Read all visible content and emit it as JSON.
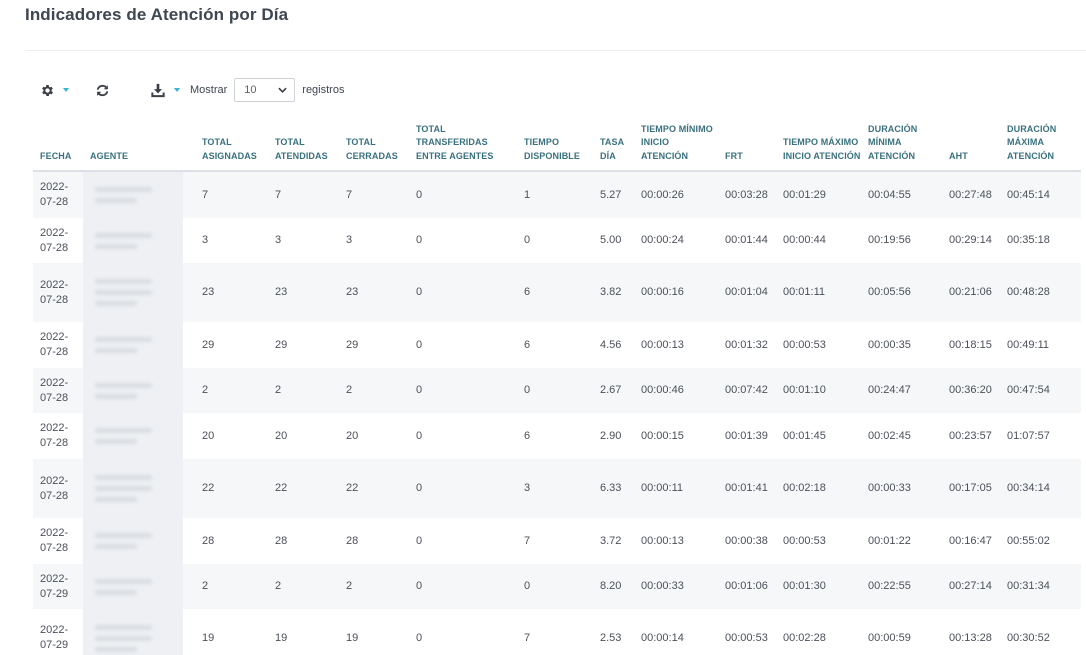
{
  "page": {
    "title": "Indicadores de Atención por Día"
  },
  "toolbar": {
    "settings_icon": "gear-icon",
    "refresh_icon": "refresh-icon",
    "download_icon": "download-icon",
    "show_label": "Mostrar",
    "page_length": "10",
    "records_label": "registros"
  },
  "table": {
    "headers": {
      "fecha": "FECHA",
      "agente": "AGENTE",
      "total_asignadas": "TOTAL ASIGNADAS",
      "total_atendidas": "TOTAL ATENDIDAS",
      "total_cerradas": "TOTAL CERRADAS",
      "total_transferidas": "TOTAL TRANSFERIDAS ENTRE AGENTES",
      "tiempo_disponible": "TIEMPO DISPONIBLE",
      "tasa_dia": "TASA DÍA",
      "tiempo_minimo": "TIEMPO MÍNIMO INICIO ATENCIÓN",
      "frt": "FRT",
      "tiempo_maximo": "TIEMPO MÁXIMO INICIO ATENCIÓN",
      "duracion_minima": "DURACIÓN MÍNIMA ATENCIÓN",
      "aht": "AHT",
      "duracion_maxima": "DURACIÓN MÁXIMA ATENCIÓN"
    },
    "rows": [
      {
        "fecha_a": "2022-",
        "fecha_b": "07-28",
        "asignadas": "7",
        "atendidas": "7",
        "cerradas": "7",
        "transferidas": "0",
        "disponible": "1",
        "tasa": "5.27",
        "t_min": "00:00:26",
        "frt": "00:03:28",
        "t_max": "00:01:29",
        "d_min": "00:04:55",
        "aht": "00:27:48",
        "d_max": "00:45:14"
      },
      {
        "fecha_a": "2022-",
        "fecha_b": "07-28",
        "asignadas": "3",
        "atendidas": "3",
        "cerradas": "3",
        "transferidas": "0",
        "disponible": "0",
        "tasa": "5.00",
        "t_min": "00:00:24",
        "frt": "00:01:44",
        "t_max": "00:00:44",
        "d_min": "00:19:56",
        "aht": "00:29:14",
        "d_max": "00:35:18"
      },
      {
        "fecha_a": "2022-",
        "fecha_b": "07-28",
        "asignadas": "23",
        "atendidas": "23",
        "cerradas": "23",
        "transferidas": "0",
        "disponible": "6",
        "tasa": "3.82",
        "t_min": "00:00:16",
        "frt": "00:01:04",
        "t_max": "00:01:11",
        "d_min": "00:05:56",
        "aht": "00:21:06",
        "d_max": "00:48:28"
      },
      {
        "fecha_a": "2022-",
        "fecha_b": "07-28",
        "asignadas": "29",
        "atendidas": "29",
        "cerradas": "29",
        "transferidas": "0",
        "disponible": "6",
        "tasa": "4.56",
        "t_min": "00:00:13",
        "frt": "00:01:32",
        "t_max": "00:00:53",
        "d_min": "00:00:35",
        "aht": "00:18:15",
        "d_max": "00:49:11"
      },
      {
        "fecha_a": "2022-",
        "fecha_b": "07-28",
        "asignadas": "2",
        "atendidas": "2",
        "cerradas": "2",
        "transferidas": "0",
        "disponible": "0",
        "tasa": "2.67",
        "t_min": "00:00:46",
        "frt": "00:07:42",
        "t_max": "00:01:10",
        "d_min": "00:24:47",
        "aht": "00:36:20",
        "d_max": "00:47:54"
      },
      {
        "fecha_a": "2022-",
        "fecha_b": "07-28",
        "asignadas": "20",
        "atendidas": "20",
        "cerradas": "20",
        "transferidas": "0",
        "disponible": "6",
        "tasa": "2.90",
        "t_min": "00:00:15",
        "frt": "00:01:39",
        "t_max": "00:01:45",
        "d_min": "00:02:45",
        "aht": "00:23:57",
        "d_max": "01:07:57"
      },
      {
        "fecha_a": "2022-",
        "fecha_b": "07-28",
        "asignadas": "22",
        "atendidas": "22",
        "cerradas": "22",
        "transferidas": "0",
        "disponible": "3",
        "tasa": "6.33",
        "t_min": "00:00:11",
        "frt": "00:01:41",
        "t_max": "00:02:18",
        "d_min": "00:00:33",
        "aht": "00:17:05",
        "d_max": "00:34:14"
      },
      {
        "fecha_a": "2022-",
        "fecha_b": "07-28",
        "asignadas": "28",
        "atendidas": "28",
        "cerradas": "28",
        "transferidas": "0",
        "disponible": "7",
        "tasa": "3.72",
        "t_min": "00:00:13",
        "frt": "00:00:38",
        "t_max": "00:00:53",
        "d_min": "00:01:22",
        "aht": "00:16:47",
        "d_max": "00:55:02"
      },
      {
        "fecha_a": "2022-",
        "fecha_b": "07-29",
        "asignadas": "2",
        "atendidas": "2",
        "cerradas": "2",
        "transferidas": "0",
        "disponible": "0",
        "tasa": "8.20",
        "t_min": "00:00:33",
        "frt": "00:01:06",
        "t_max": "00:01:30",
        "d_min": "00:22:55",
        "aht": "00:27:14",
        "d_max": "00:31:34"
      },
      {
        "fecha_a": "2022-",
        "fecha_b": "07-29",
        "asignadas": "19",
        "atendidas": "19",
        "cerradas": "19",
        "transferidas": "0",
        "disponible": "7",
        "tasa": "2.53",
        "t_min": "00:00:14",
        "frt": "00:00:53",
        "t_max": "00:02:28",
        "d_min": "00:00:59",
        "aht": "00:13:28",
        "d_max": "00:30:52"
      }
    ]
  }
}
